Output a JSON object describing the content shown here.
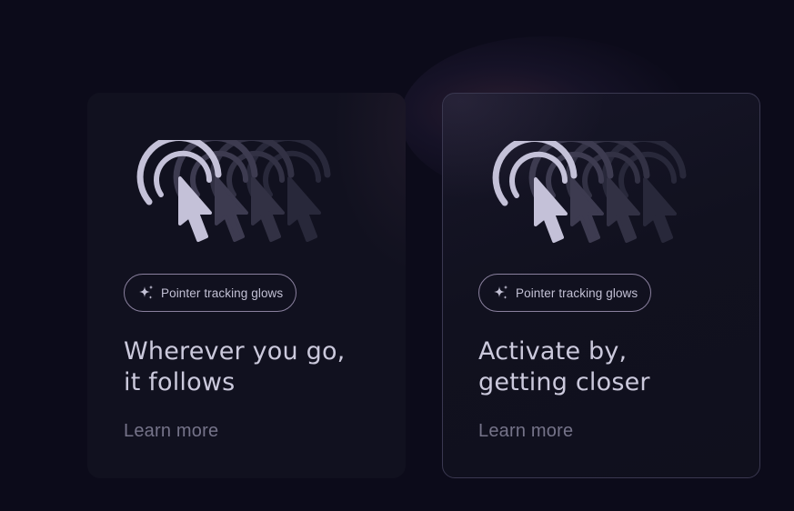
{
  "colors": {
    "background": "#0c0b1a",
    "card": "#11111f",
    "card_border_active": "#3a3850",
    "cursor_main": "#c4c1d8",
    "cursor_ghost": "#3a384c",
    "badge_border": "#8a809e",
    "title_text": "#cbc9dc",
    "link_text": "#757389"
  },
  "cards": [
    {
      "icon": "pointer-tracking-icon",
      "badge": {
        "icon": "sparkle-icon",
        "label": "Pointer tracking glows"
      },
      "title_line1": "Wherever you go,",
      "title_line2": "it follows",
      "link": "Learn more"
    },
    {
      "icon": "pointer-tracking-icon",
      "badge": {
        "icon": "sparkle-icon",
        "label": "Pointer tracking glows"
      },
      "title_line1": "Activate by,",
      "title_line2": "getting closer",
      "link": "Learn more"
    }
  ]
}
